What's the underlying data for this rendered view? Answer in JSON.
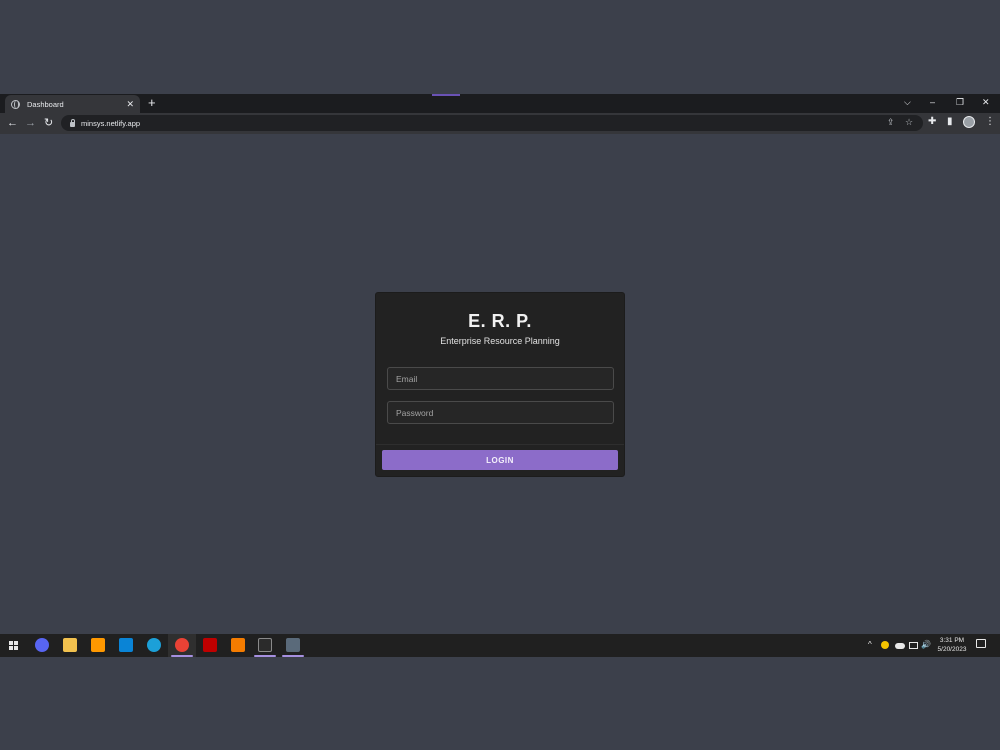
{
  "browser": {
    "tab_title": "Dashboard",
    "tab_close": "✕",
    "new_tab": "+",
    "url": "minsys.netlify.app",
    "controls": {
      "dropdown": "⌵",
      "minimize": "–",
      "restore": "❐",
      "close": "✕"
    },
    "nav": {
      "back": "←",
      "forward": "→",
      "reload": "↻"
    },
    "icons": {
      "share": "⇪",
      "star": "☆",
      "extensions": "✚",
      "sidepanel": "▮",
      "menu": "⋮"
    }
  },
  "login": {
    "title": "E. R. P.",
    "subtitle": "Enterprise Resource Planning",
    "email_placeholder": "Email",
    "password_placeholder": "Password",
    "button_label": "LOGIN"
  },
  "taskbar": {
    "apps": [
      {
        "name": "discord-icon",
        "color": "#5865f2"
      },
      {
        "name": "file-explorer-icon",
        "color": "#f2c14e"
      },
      {
        "name": "sublime-text-icon",
        "color": "#ff9800"
      },
      {
        "name": "vscode-icon",
        "color": "#0a84d6"
      },
      {
        "name": "edge-icon",
        "color": "#1ca0d8"
      },
      {
        "name": "chrome-icon",
        "color": "#e94235"
      },
      {
        "name": "filezilla-icon",
        "color": "#bf0000"
      },
      {
        "name": "xampp-icon",
        "color": "#f57c00"
      },
      {
        "name": "terminal-icon",
        "color": "#2b2b2b"
      },
      {
        "name": "calculator-icon",
        "color": "#5a6a7a"
      }
    ],
    "tray": {
      "chevron": "^",
      "volume": "🔊"
    },
    "time": "3:31 PM",
    "date": "5/20/2023"
  },
  "colors": {
    "background": "#3c404b",
    "card": "#222222",
    "button": "#8c6cc9",
    "accent": "#a690e0"
  }
}
